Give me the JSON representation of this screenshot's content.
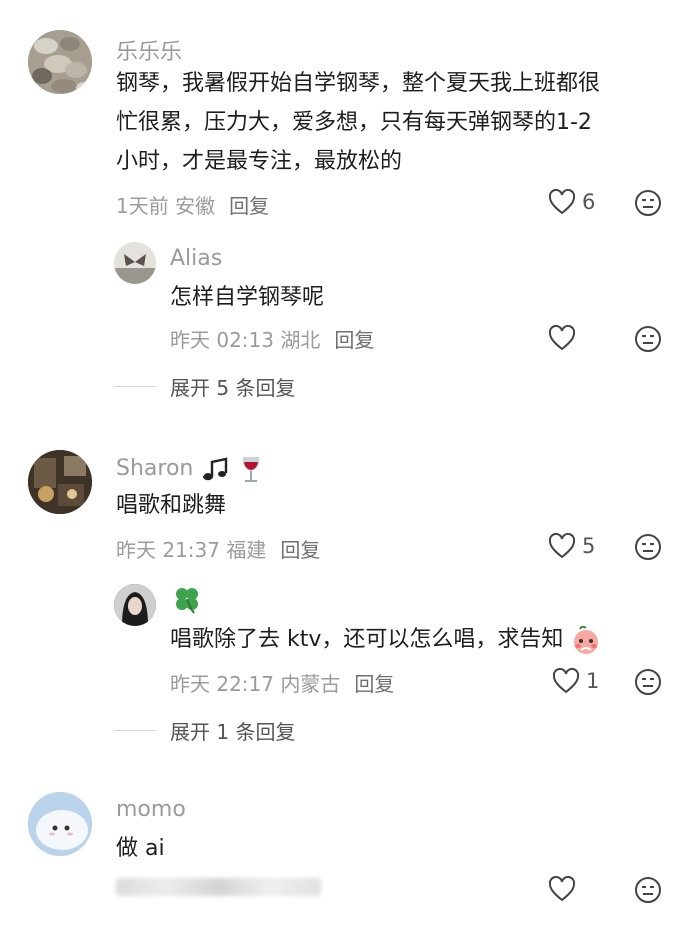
{
  "comments": [
    {
      "username": "乐乐乐",
      "lines": [
        "钢琴，我暑假开始自学钢琴，整个夏天我上班都很",
        "忙很累，压力大，爱多想，只有每天弹钢琴的1-2",
        "小时，才是最专注，最放松的"
      ],
      "meta": "1天前 安徽",
      "reply_label": "回复",
      "likes": "6",
      "replies": [
        {
          "username": "Alias",
          "text": "怎样自学钢琴呢",
          "meta": "昨天 02:13 湖北",
          "reply_label": "回复",
          "likes": ""
        }
      ],
      "expand_label": "展开 5 条回复"
    },
    {
      "username": "Sharon",
      "username_emoji": [
        "music-notes",
        "wine-glass"
      ],
      "text": "唱歌和跳舞",
      "meta": "昨天 21:37 福建",
      "reply_label": "回复",
      "likes": "5",
      "replies": [
        {
          "username": "",
          "username_emoji": [
            "four-leaf-clover"
          ],
          "text": "唱歌除了去 ktv，还可以怎么唱，求告知",
          "trailing_emoji": "shy-peach-face",
          "meta": "昨天 22:17 内蒙古",
          "reply_label": "回复",
          "likes": "1"
        }
      ],
      "expand_label": "展开 1 条回复"
    },
    {
      "username": "momo",
      "text": "做 ai",
      "likes": ""
    }
  ],
  "colors": {
    "text": "#1e1e1e",
    "secondary": "#9a9a9a",
    "icon": "#444444"
  }
}
